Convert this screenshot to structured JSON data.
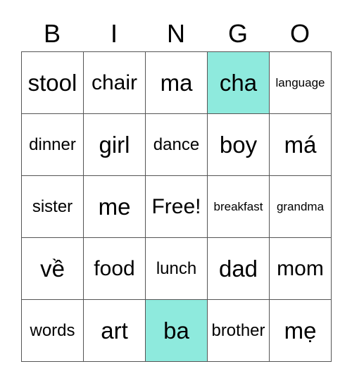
{
  "header": [
    "B",
    "I",
    "N",
    "G",
    "O"
  ],
  "highlight_color": "#8eeadd",
  "cells": [
    {
      "text": "stool",
      "marked": false
    },
    {
      "text": "chair",
      "marked": false
    },
    {
      "text": "ma",
      "marked": false
    },
    {
      "text": "cha",
      "marked": true
    },
    {
      "text": "language",
      "marked": false
    },
    {
      "text": "dinner",
      "marked": false
    },
    {
      "text": "girl",
      "marked": false
    },
    {
      "text": "dance",
      "marked": false
    },
    {
      "text": "boy",
      "marked": false
    },
    {
      "text": "má",
      "marked": false
    },
    {
      "text": "sister",
      "marked": false
    },
    {
      "text": "me",
      "marked": false
    },
    {
      "text": "Free!",
      "marked": false
    },
    {
      "text": "breakfast",
      "marked": false
    },
    {
      "text": "grandma",
      "marked": false
    },
    {
      "text": "về",
      "marked": false
    },
    {
      "text": "food",
      "marked": false
    },
    {
      "text": "lunch",
      "marked": false
    },
    {
      "text": "dad",
      "marked": false
    },
    {
      "text": "mom",
      "marked": false
    },
    {
      "text": "words",
      "marked": false
    },
    {
      "text": "art",
      "marked": false
    },
    {
      "text": "ba",
      "marked": true
    },
    {
      "text": "brother",
      "marked": false
    },
    {
      "text": "mẹ",
      "marked": false
    }
  ]
}
